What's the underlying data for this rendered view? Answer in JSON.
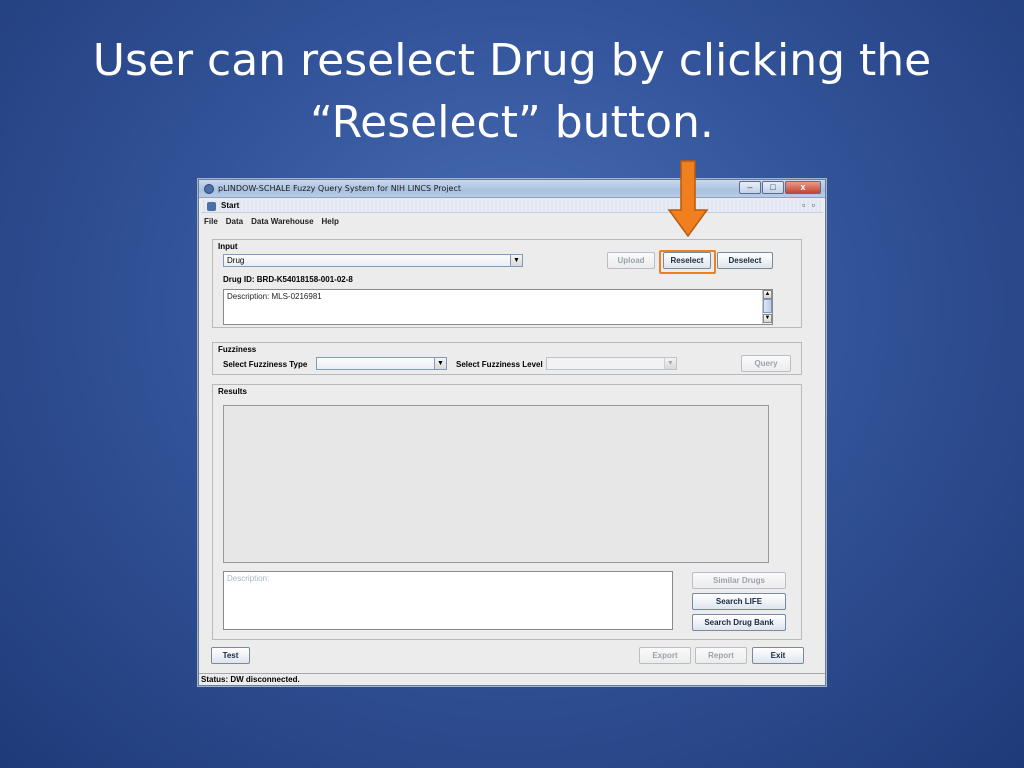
{
  "slide": {
    "title_line1": "User can reselect Drug by clicking the",
    "title_line2": "“Reselect” button."
  },
  "window": {
    "title": "pLINDOW-SCHALE Fuzzy Query System for NIH LINCS Project",
    "controls": {
      "minimize": "–",
      "maximize": "□",
      "close": "x"
    },
    "inner_frame": {
      "title": "Start",
      "controls": "▫ ▫"
    }
  },
  "menu": [
    "File",
    "Data",
    "Data Warehouse",
    "Help"
  ],
  "input_panel": {
    "label": "Input",
    "drug_combo": "Drug",
    "upload_label": "Upload",
    "reselect_label": "Reselect",
    "deselect_label": "Deselect",
    "drug_id": "Drug ID: BRD-K54018158-001-02-8",
    "description": "Description:  MLS-0216981"
  },
  "fuzziness_panel": {
    "label": "Fuzziness",
    "type_label": "Select Fuzziness Type",
    "type_value": "",
    "level_label": "Select Fuzziness Level",
    "level_value": "",
    "query_label": "Query"
  },
  "results_panel": {
    "label": "Results",
    "description_placeholder": "Description:",
    "similar_drugs_label": "Similar Drugs",
    "search_life_label": "Search LIFE",
    "search_drugbank_label": "Search Drug Bank"
  },
  "bottom_bar": {
    "test_label": "Test",
    "export_label": "Export",
    "report_label": "Report",
    "exit_label": "Exit"
  },
  "status": "Status: DW disconnected.",
  "colors": {
    "highlight": "#f07f1f",
    "background": "#33549a"
  }
}
